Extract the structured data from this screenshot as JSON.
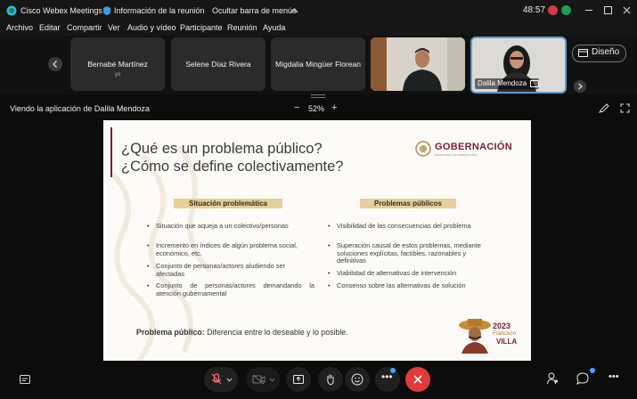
{
  "window": {
    "app_title": "Cisco Webex Meetings",
    "meeting_info": "Información de la reunión",
    "hide_menu": "Ocultar barra de menús",
    "timer": "48:57"
  },
  "menu": [
    "Archivo",
    "Editar",
    "Compartir",
    "Ver",
    "Audio y vídeo",
    "Participante",
    "Reunión",
    "Ayuda"
  ],
  "participants": {
    "tile1": {
      "name": "Bernabé Martínez",
      "sub": "yo"
    },
    "tile2": {
      "name": "Selene Díaz Rivera"
    },
    "tile3": {
      "name": "Migdalia Mingüer Florean"
    },
    "tile5": {
      "name": "Dalila Mendoza"
    },
    "layout_label": "Diseño"
  },
  "view": {
    "viewing_label": "Viendo la aplicación de Dalila Mendoza",
    "zoom_minus": "−",
    "zoom": "52%",
    "zoom_plus": "+"
  },
  "slide": {
    "title_line1": "¿Qué es un problema público?",
    "title_line2": "¿Cómo se define colectivamente?",
    "logo_text": "GOBERNACIÓN",
    "logo_sub": "SECRETARÍA DE GOBERNACIÓN",
    "left_heading": "Situación problemática",
    "right_heading": "Problemas públicos",
    "left_items": [
      "Situación que aqueja a un colectivo/personas",
      "Incremento en índices de algún problema social, económico, etc.",
      "Conjunto de personas/actores aludiendo ser afectadas",
      "Conjunto de personas/actores demandando la atención gubernamental"
    ],
    "right_items": [
      "Visibilidad de las consecuencias del problema",
      "Superación causal de estos problemas, mediante soluciones explícitas, factibles, razonables y definitivas",
      "Viabilidad de alternativas de intervención",
      "Consenso sobre las alternativas de solución"
    ],
    "footer_bold": "Problema público:",
    "footer_text": " Diferencia entre lo deseable y lo posible.",
    "badge_year": "2023",
    "badge_name1": "Francisco",
    "badge_name2": "VILLA"
  },
  "colors": {
    "accent_maroon": "#7a1f35",
    "heading_gold": "#e7cf9a",
    "hangup_red": "#e23a3a",
    "active_tile_border": "#5b9bd5"
  }
}
